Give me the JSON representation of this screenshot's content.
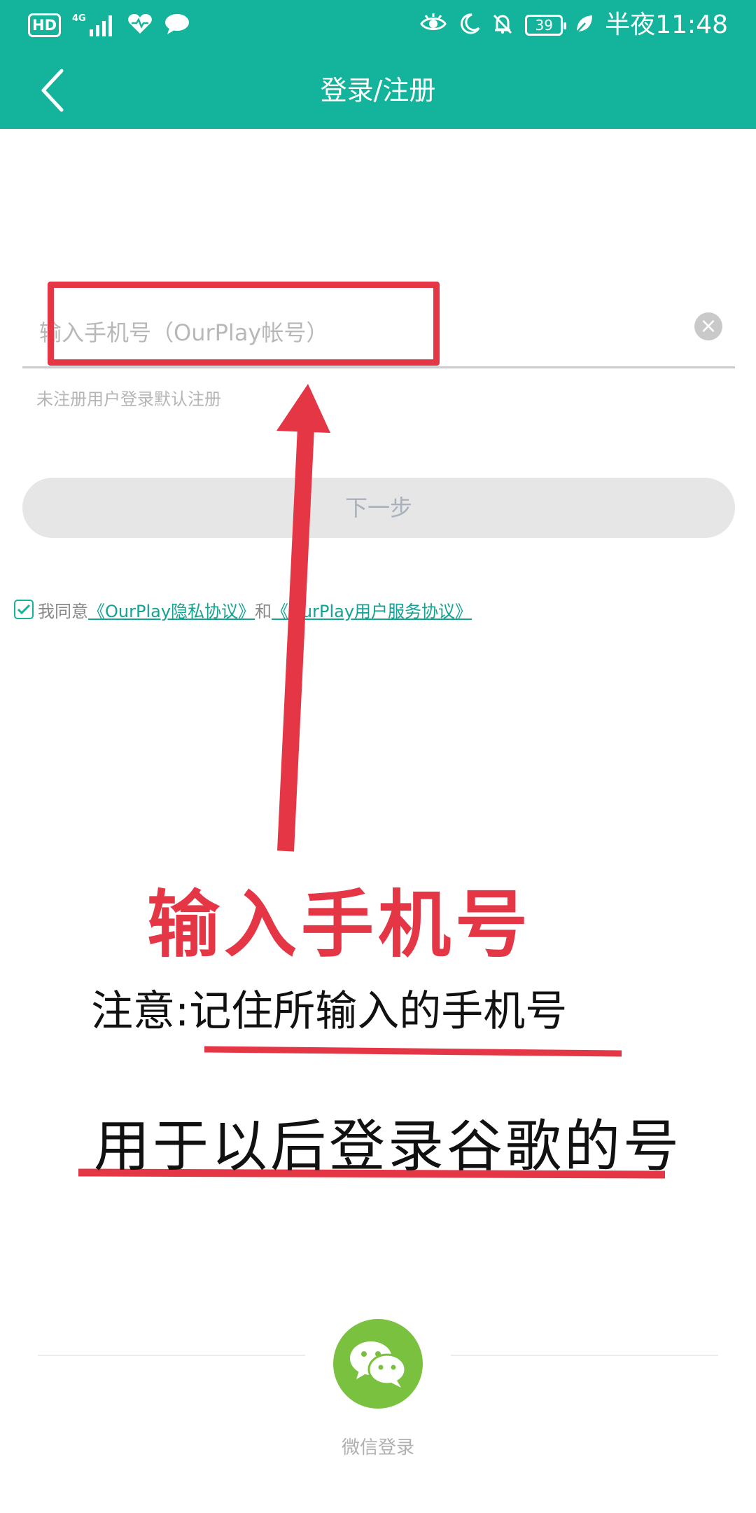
{
  "status_bar": {
    "hd": "HD",
    "network": "4G",
    "battery": "39",
    "time": "半夜11:48"
  },
  "appbar": {
    "title": "登录/注册"
  },
  "form": {
    "phone_placeholder": "输入手机号（OurPlay帐号）",
    "hint": "未注册用户登录默认注册",
    "next_label": "下一步"
  },
  "agreement": {
    "prefix": "我同意",
    "privacy_link": "《OurPlay隐私协议》",
    "and": "和",
    "service_link": "《OurPlay用户服务协议》"
  },
  "annotations": {
    "main": "输入手机号",
    "note": "注意:记住所输入的手机号",
    "note2": "用于以后登录谷歌的号"
  },
  "wechat": {
    "label": "微信登录"
  },
  "colors": {
    "primary": "#14b39b",
    "annotation_red": "#e53645",
    "wechat_green": "#7ac13f"
  }
}
